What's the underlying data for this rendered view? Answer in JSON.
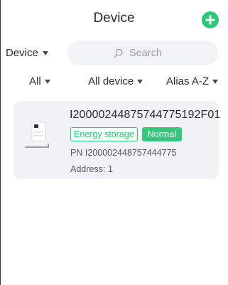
{
  "header": {
    "title": "Device"
  },
  "filters": {
    "type_select": "Device",
    "search_placeholder": "Search",
    "status_filter": "All",
    "device_filter": "All device",
    "sort_filter": "Alias A-Z"
  },
  "devices": [
    {
      "serial": "I20000244875744775192F01",
      "type_tag": "Energy storage",
      "status": "Normal",
      "pn_label": "PN",
      "pn": "I200002448757444775",
      "address_label": "Address:",
      "address": "1"
    }
  ],
  "colors": {
    "accent": "#2ec77a",
    "card_bg": "#f0f2f5",
    "search_bg": "#f1f3f6"
  },
  "icons": {
    "add": "plus-circle-icon",
    "search": "search-icon",
    "dropdown": "caret-down-icon"
  }
}
